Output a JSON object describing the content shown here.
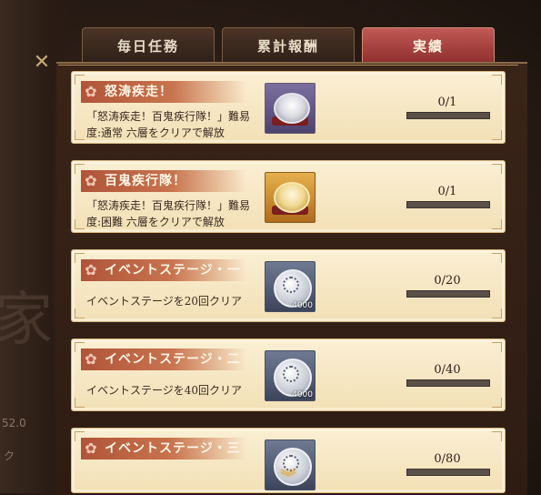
{
  "tabs": [
    {
      "label": "毎日任務",
      "active": false
    },
    {
      "label": "累計報酬",
      "active": false
    },
    {
      "label": "実績",
      "active": true
    }
  ],
  "background": {
    "kanji": "家",
    "text_fragment_1": "52.0",
    "text_fragment_2": "ク"
  },
  "achievements": [
    {
      "title": "怒涛疾走！",
      "description_line1": "「怒涛疾走！百鬼疾行隊！」難易",
      "description_line2": "度:通常 六層をクリアで解放",
      "reward_icon": "helmet-icon",
      "reward_color": "purple",
      "reward_quantity": "",
      "progress_text": "0/1",
      "progress_fraction": 0
    },
    {
      "title": "百鬼疾行隊！",
      "description_line1": "「怒涛疾走！百鬼疾行隊！」難易",
      "description_line2": "度:困難 六層をクリアで解放",
      "reward_icon": "helmet-icon",
      "reward_color": "gold",
      "reward_quantity": "",
      "progress_text": "0/1",
      "progress_fraction": 0
    },
    {
      "title": "イベントステージ・一",
      "description_line1": "イベントステージを20回クリア",
      "description_line2": "",
      "reward_icon": "silver-coin-icon",
      "reward_color": "gray",
      "reward_quantity": "4000",
      "progress_text": "0/20",
      "progress_fraction": 0
    },
    {
      "title": "イベントステージ・二",
      "description_line1": "イベントステージを40回クリア",
      "description_line2": "",
      "reward_icon": "silver-coin-icon",
      "reward_color": "gray",
      "reward_quantity": "4000",
      "progress_text": "0/40",
      "progress_fraction": 0
    },
    {
      "title": "イベントステージ・三",
      "description_line1": "",
      "description_line2": "",
      "reward_icon": "silver-coin-icon",
      "reward_color": "gray",
      "reward_quantity": "",
      "progress_text": "0/80",
      "progress_fraction": 0
    }
  ],
  "icons": {
    "panel_deco": "cross-ornament-icon",
    "card_flower": "sakura-icon",
    "scroll_hint": "double-chevron-down-icon"
  }
}
